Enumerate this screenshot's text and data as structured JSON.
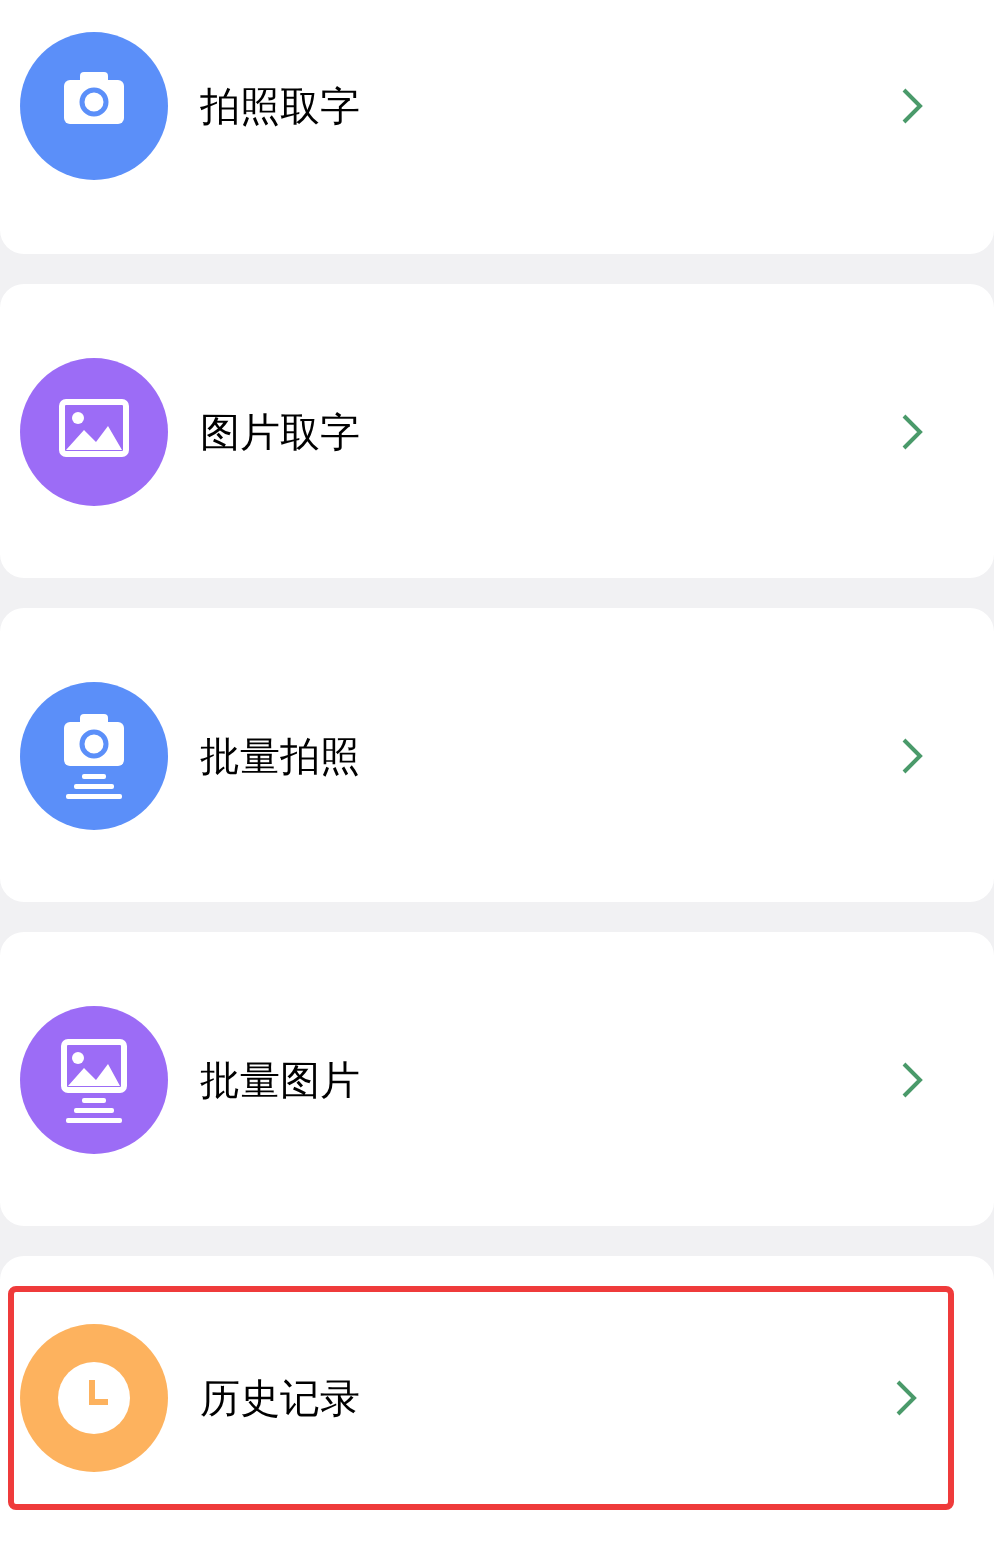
{
  "menu_items": [
    {
      "label": "拍照取字",
      "kind": "camera",
      "color": "#5b8ff9",
      "highlighted": false
    },
    {
      "label": "图片取字",
      "kind": "image",
      "color": "#9c6cf6",
      "highlighted": false
    },
    {
      "label": "批量拍照",
      "kind": "camera-batch",
      "color": "#5b8ff9",
      "highlighted": false
    },
    {
      "label": "批量图片",
      "kind": "image-batch",
      "color": "#9c6cf6",
      "highlighted": false
    },
    {
      "label": "历史记录",
      "kind": "clock",
      "color": "#fdb25e",
      "highlighted": true
    }
  ]
}
